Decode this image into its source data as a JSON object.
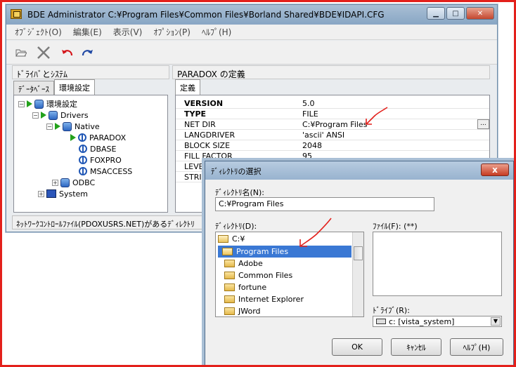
{
  "main_window": {
    "title": "BDE Administrator  C:¥Program Files¥Common Files¥Borland Shared¥BDE¥IDAPI.CFG",
    "menu": [
      "ｵﾌﾞｼﾞｪｸﾄ(O)",
      "編集(E)",
      "表示(V)",
      "ｵﾌﾟｼｮﾝ(P)",
      "ﾍﾙﾌﾟ(H)"
    ],
    "left_header": "ﾄﾞﾗｲﾊﾞとｼｽﾃﾑ",
    "right_header": "PARADOX の定義",
    "left_tabs": [
      "ﾃﾞｰﾀﾍﾞｰｽ",
      "環境設定"
    ],
    "right_tabs": [
      "定義"
    ],
    "tree": {
      "root": "環境設定",
      "drivers": "Drivers",
      "native": "Native",
      "paradox": "PARADOX",
      "dbase": "DBASE",
      "foxpro": "FOXPRO",
      "msaccess": "MSACCESS",
      "odbc": "ODBC",
      "system": "System"
    },
    "properties": [
      {
        "key": "VERSION",
        "value": "5.0"
      },
      {
        "key": "TYPE",
        "value": "FILE"
      },
      {
        "key": "NET DIR",
        "value": "C:¥Program Files"
      },
      {
        "key": "LANGDRIVER",
        "value": "'ascii' ANSI"
      },
      {
        "key": "BLOCK SIZE",
        "value": "2048"
      },
      {
        "key": "FILL FACTOR",
        "value": "95"
      },
      {
        "key": "LEVEL",
        "value": ""
      },
      {
        "key": "STRICT",
        "value": ""
      }
    ],
    "ellipsis": "...",
    "status": "ﾈｯﾄﾜｰｸｺﾝﾄﾛｰﾙﾌｧｲﾙ(PDOXUSRS.NET)があるﾃﾞｨﾚｸﾄﾘ"
  },
  "dialog": {
    "title": "ﾃﾞｨﾚｸﾄﾘの選択",
    "close": "x",
    "dirname_label": "ﾃﾞｨﾚｸﾄﾘ名(N):",
    "dirname_value": "C:¥Program Files",
    "dir_label": "ﾃﾞｨﾚｸﾄﾘ(D):",
    "file_label": "ﾌｧｲﾙ(F): (**)",
    "dirs": [
      "C:¥",
      "Program Files",
      "Adobe",
      "Common Files",
      "fortune",
      "Internet Explorer",
      "JWord"
    ],
    "drive_label": "ﾄﾞﾗｲﾌﾞ(R):",
    "drive_value": "c: [vista_system]",
    "ok": "OK",
    "cancel": "ｷｬﾝｾﾙ",
    "help": "ﾍﾙﾌﾟ(H)"
  },
  "colors": {
    "annotation": "#e3201b",
    "selection": "#3a78d4"
  }
}
